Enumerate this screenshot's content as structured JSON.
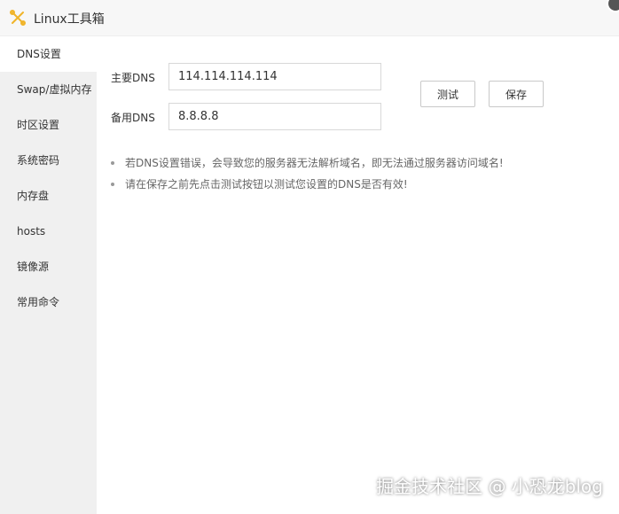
{
  "header": {
    "title": "Linux工具箱",
    "logo_icon": "tools-icon",
    "close_icon": "close-icon"
  },
  "sidebar": {
    "items": [
      {
        "label": "DNS设置",
        "active": true
      },
      {
        "label": "Swap/虚拟内存"
      },
      {
        "label": "时区设置"
      },
      {
        "label": "系统密码"
      },
      {
        "label": "内存盘"
      },
      {
        "label": "hosts"
      },
      {
        "label": "镜像源"
      },
      {
        "label": "常用命令"
      }
    ]
  },
  "main": {
    "primary_dns_label": "主要DNS",
    "primary_dns_value": "114.114.114.114",
    "backup_dns_label": "备用DNS",
    "backup_dns_value": "8.8.8.8",
    "test_button": "测试",
    "save_button": "保存",
    "tips": [
      "若DNS设置错误，会导致您的服务器无法解析域名，即无法通过服务器访问域名!",
      "请在保存之前先点击测试按钮以测试您设置的DNS是否有效!"
    ]
  },
  "watermark": "掘金技术社区 @ 小恐龙blog"
}
